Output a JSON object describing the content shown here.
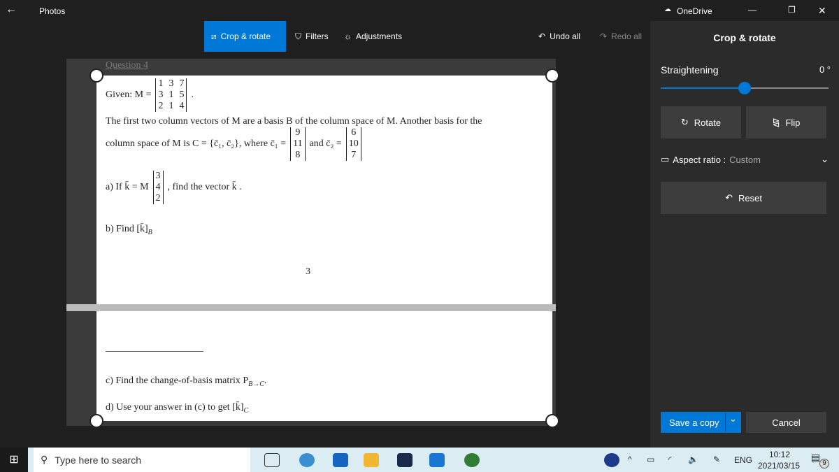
{
  "window": {
    "app_title": "Photos",
    "onedrive": "OneDrive",
    "back": "←",
    "minimize": "—",
    "maximize": "❐",
    "close": "✕"
  },
  "toolbar": {
    "crop_rotate": "Crop & rotate",
    "filters": "Filters",
    "adjustments": "Adjustments",
    "undo_all": "Undo all",
    "redo_all": "Redo all"
  },
  "document": {
    "question": "Question 4",
    "given": "Given:  M =",
    "matrix_M": [
      "1",
      "3",
      "7",
      "3",
      "1",
      "5",
      "2",
      "1",
      "4"
    ],
    "line1": "The first two column vectors of M are a basis B of the column space of M. Another basis for the",
    "line2a": "column space of M is C = {c̄₁, c̄₂}, where c̄₁ =",
    "c1": [
      "9",
      "11",
      "8"
    ],
    "line2b": "and c̄₂ =",
    "c2": [
      "6",
      "10",
      "7"
    ],
    "part_a1": "a)  If k̄ = M",
    "vec_a": [
      "3",
      "4",
      "2"
    ],
    "part_a2": ", find the vector k̄ .",
    "part_b": "b)  Find [k̄]",
    "part_b_sub": "B",
    "page_number": "3",
    "part_c": "c)  Find the change-of-basis matrix P",
    "part_c_sub": "B→C",
    "part_d": "d)  Use your answer in (c) to get [k̄]",
    "part_d_sub": "C"
  },
  "panel": {
    "title": "Crop & rotate",
    "straightening": "Straightening",
    "angle": "0 °",
    "straighten_value": 0,
    "rotate": "Rotate",
    "flip": "Flip",
    "aspect_label": "Aspect ratio :",
    "aspect_value": "Custom",
    "reset": "Reset",
    "save_copy": "Save a copy",
    "cancel": "Cancel",
    "accent": "#0078d7"
  },
  "taskbar": {
    "search_placeholder": "Type here to search",
    "lang": "ENG",
    "time": "10:12",
    "date": "2021/03/15",
    "notifications": "9"
  }
}
